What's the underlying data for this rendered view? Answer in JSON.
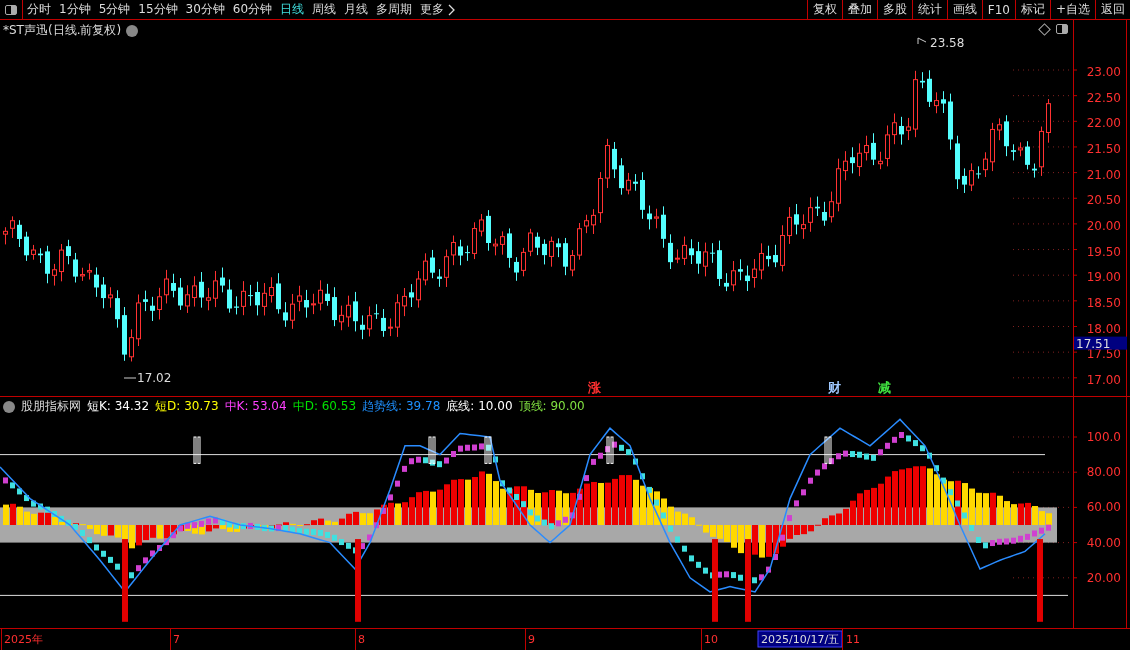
{
  "toolbar": {
    "periods": [
      {
        "label": "分时",
        "selected": false
      },
      {
        "label": "1分钟",
        "selected": false
      },
      {
        "label": "5分钟",
        "selected": false
      },
      {
        "label": "15分钟",
        "selected": false
      },
      {
        "label": "30分钟",
        "selected": false
      },
      {
        "label": "60分钟",
        "selected": false
      },
      {
        "label": "日线",
        "selected": true
      },
      {
        "label": "周线",
        "selected": false
      },
      {
        "label": "月线",
        "selected": false
      },
      {
        "label": "多周期",
        "selected": false
      }
    ],
    "more": "更多",
    "actions": [
      "复权",
      "叠加",
      "多股",
      "统计",
      "画线",
      "F10",
      "标记",
      "+自选",
      "返回"
    ]
  },
  "price_chart": {
    "title": "*ST声迅(日线.前复权)",
    "axis_labels": [
      "23.00",
      "22.50",
      "22.00",
      "21.50",
      "21.00",
      "20.50",
      "20.00",
      "19.50",
      "19.00",
      "18.50",
      "18.00",
      "17.50",
      "17.00"
    ],
    "high_label": "23.58",
    "low_label": "17.02",
    "current_price": "17.51",
    "event_marks": [
      {
        "label": "涨",
        "color": "#ff3030"
      },
      {
        "label": "财",
        "color": "#9fc8ff"
      },
      {
        "label": "减",
        "color": "#40e040"
      }
    ]
  },
  "indicator": {
    "name": "股朋指标网",
    "legend": [
      {
        "label": "短K: 34.32",
        "color": "#ffffff"
      },
      {
        "label": "短D: 30.73",
        "color": "#ffff00"
      },
      {
        "label": "中K: 53.04",
        "color": "#ff40ff"
      },
      {
        "label": "中D: 60.53",
        "color": "#00e000"
      },
      {
        "label": "趋势线: 39.78",
        "color": "#1e90ff"
      },
      {
        "label": "底线: 10.00",
        "color": "#ffffff"
      },
      {
        "label": "顶线: 90.00",
        "color": "#80e040"
      }
    ],
    "axis_labels": [
      "100.0",
      "80.00",
      "60.00",
      "40.00",
      "20.00"
    ]
  },
  "time_axis": {
    "labels": [
      "2025年",
      "7",
      "8",
      "9",
      "10"
    ],
    "cursor_date": "2025/10/17/五",
    "after_cursor": "11"
  }
}
